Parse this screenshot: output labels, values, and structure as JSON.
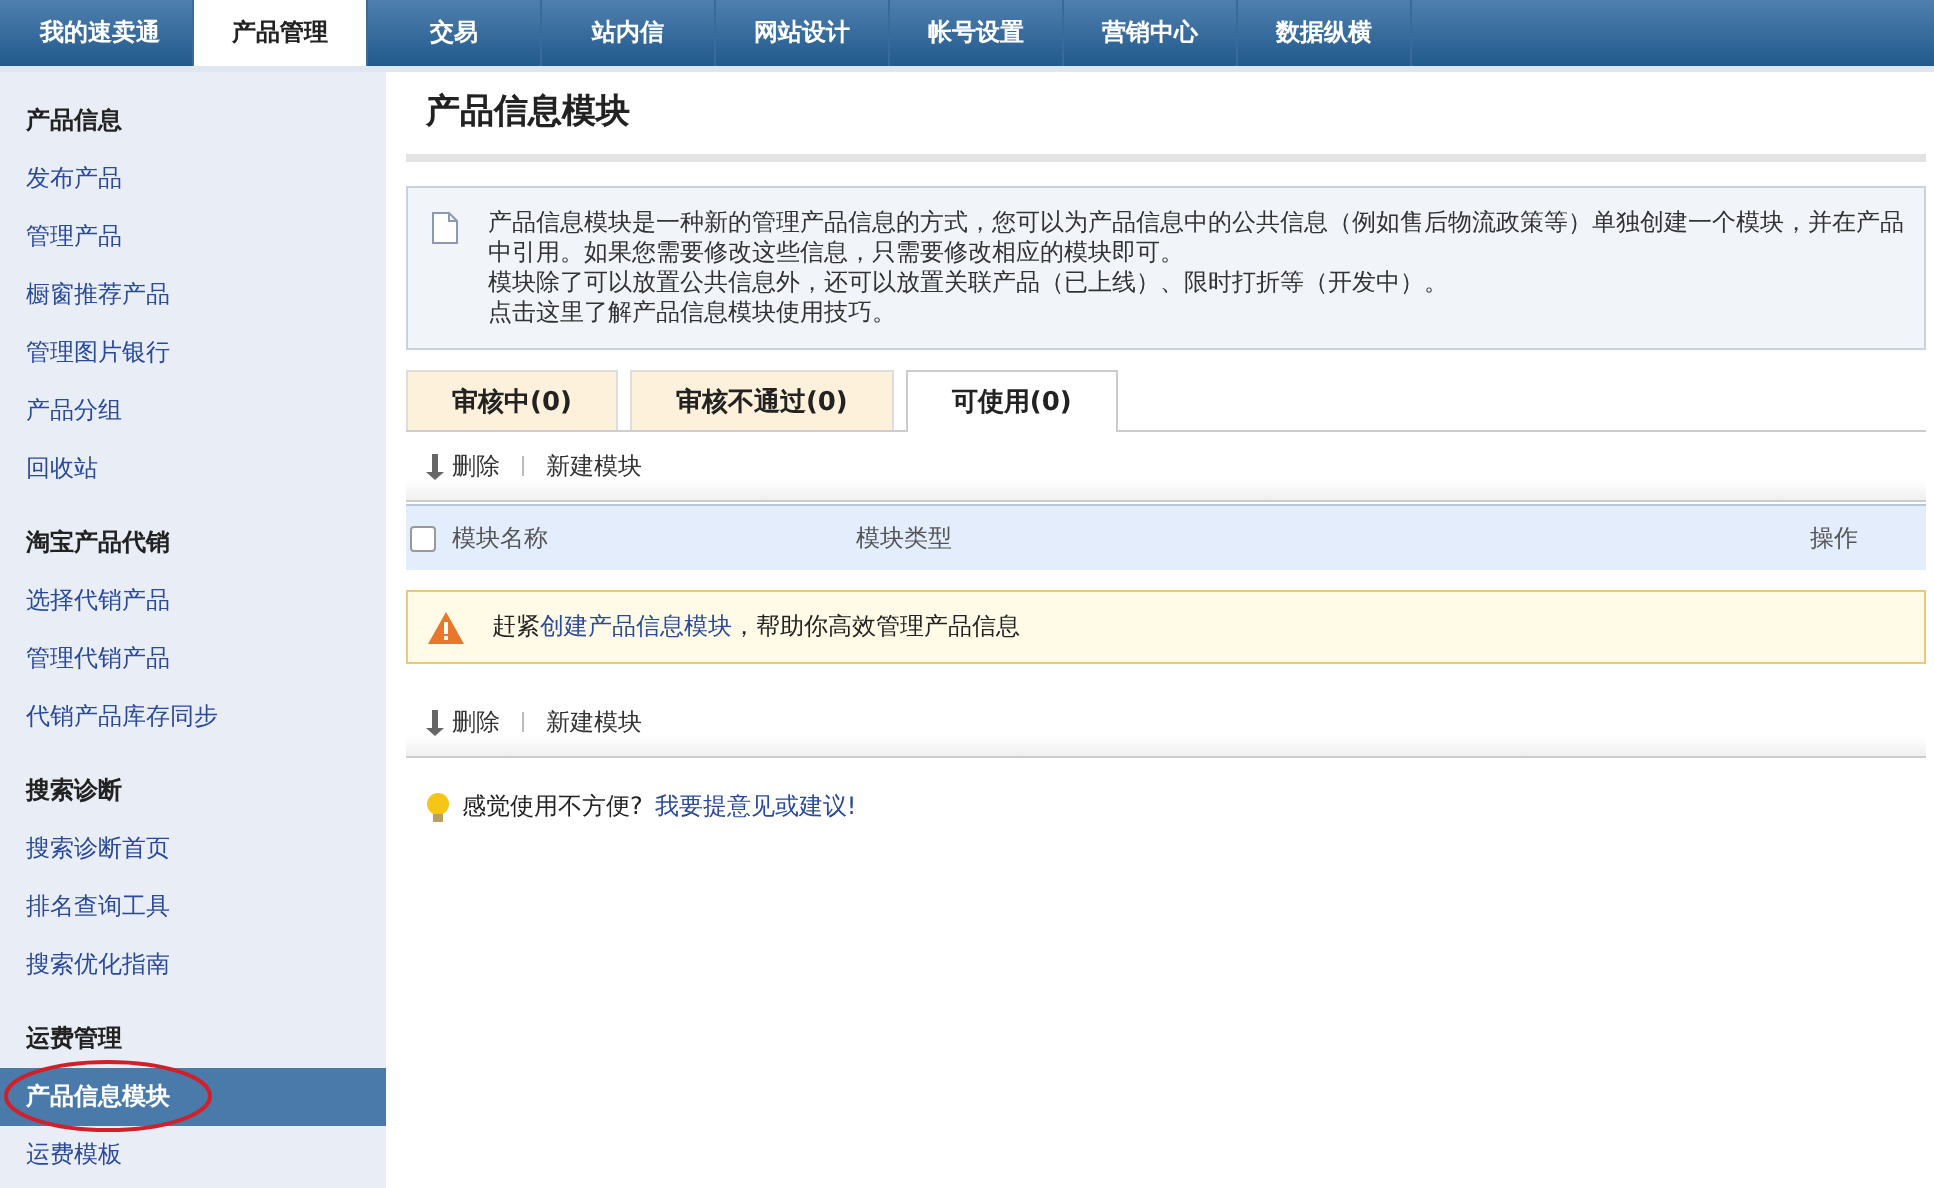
{
  "top_nav": [
    {
      "label": "我的速卖通",
      "selected": false
    },
    {
      "label": "产品管理",
      "selected": true
    },
    {
      "label": "交易",
      "selected": false
    },
    {
      "label": "站内信",
      "selected": false
    },
    {
      "label": "网站设计",
      "selected": false
    },
    {
      "label": "帐号设置",
      "selected": false
    },
    {
      "label": "营销中心",
      "selected": false
    },
    {
      "label": "数据纵横",
      "selected": false
    }
  ],
  "sidebar": {
    "groups": [
      {
        "title": "产品信息",
        "items": [
          {
            "label": "发布产品",
            "selected": false,
            "circled": false
          },
          {
            "label": "管理产品",
            "selected": false,
            "circled": false
          },
          {
            "label": "橱窗推荐产品",
            "selected": false,
            "circled": false
          },
          {
            "label": "管理图片银行",
            "selected": false,
            "circled": false
          },
          {
            "label": "产品分组",
            "selected": false,
            "circled": false
          },
          {
            "label": "回收站",
            "selected": false,
            "circled": false
          }
        ]
      },
      {
        "title": "淘宝产品代销",
        "items": [
          {
            "label": "选择代销产品",
            "selected": false,
            "circled": false
          },
          {
            "label": "管理代销产品",
            "selected": false,
            "circled": false
          },
          {
            "label": "代销产品库存同步",
            "selected": false,
            "circled": false
          }
        ]
      },
      {
        "title": "搜索诊断",
        "items": [
          {
            "label": "搜索诊断首页",
            "selected": false,
            "circled": false
          },
          {
            "label": "排名查询工具",
            "selected": false,
            "circled": false
          },
          {
            "label": "搜索优化指南",
            "selected": false,
            "circled": false
          }
        ]
      },
      {
        "title": "运费管理",
        "items": [
          {
            "label": "产品信息模块",
            "selected": true,
            "circled": true
          },
          {
            "label": "运费模板",
            "selected": false,
            "circled": false
          }
        ]
      }
    ]
  },
  "page_title": "产品信息模块",
  "info_box": {
    "lines": [
      "产品信息模块是一种新的管理产品信息的方式，您可以为产品信息中的公共信息（例如售后物流政策等）单独创建一个模块，并在产品中引用。如果您需要修改这些信息，只需要修改相应的模块即可。",
      "模块除了可以放置公共信息外，还可以放置关联产品（已上线）、限时打折等（开发中）。",
      "点击这里了解产品信息模块使用技巧。"
    ]
  },
  "tabs": [
    {
      "label": "审核中(0)",
      "selected": false
    },
    {
      "label": "审核不通过(0)",
      "selected": false
    },
    {
      "label": "可使用(0)",
      "selected": true
    }
  ],
  "toolbar_top": {
    "delete": "删除",
    "new": "新建模块"
  },
  "table": {
    "select_all_checked": false,
    "columns": [
      "模块名称",
      "模块类型",
      "操作"
    ]
  },
  "notice": {
    "before": "赶紧",
    "link": "创建产品信息模块",
    "after": "，帮助你高效管理产品信息"
  },
  "toolbar_bottom": {
    "delete": "删除",
    "new": "新建模块"
  },
  "feedback": {
    "text": "感觉使用不方便?",
    "link": "我要提意见或建议!"
  }
}
